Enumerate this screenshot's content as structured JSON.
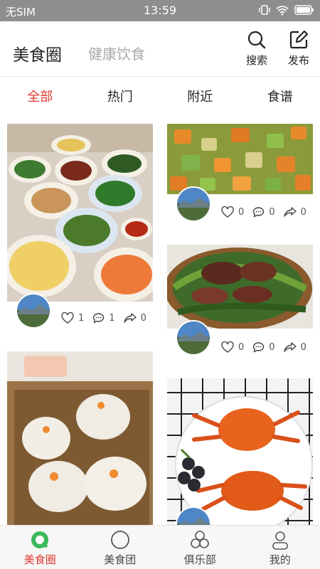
{
  "status_bar": {
    "carrier": "无SIM",
    "time": "13:59"
  },
  "header": {
    "title": "美食圈",
    "subtitle": "健康饮食",
    "search_label": "搜索",
    "publish_label": "发布"
  },
  "tabs": [
    {
      "label": "全部",
      "active": true
    },
    {
      "label": "热门",
      "active": false
    },
    {
      "label": "附近",
      "active": false
    },
    {
      "label": "食谱",
      "active": false
    }
  ],
  "posts": [
    {
      "likes": "1",
      "comments": "1",
      "shares": "0",
      "image": "table-of-dishes-photo"
    },
    {
      "likes": "0",
      "comments": "0",
      "shares": "0",
      "image": "stir-fried-vegetables-photo"
    },
    {
      "likes": "0",
      "comments": "0",
      "shares": "0",
      "image": "beef-with-greens-photo"
    },
    {
      "image": "shrimp-dumplings-photo"
    },
    {
      "image": "steamed-crabs-photo"
    }
  ],
  "bottom_nav": [
    {
      "label": "美食圈",
      "active": true
    },
    {
      "label": "美食团",
      "active": false
    },
    {
      "label": "俱乐部",
      "active": false
    },
    {
      "label": "我的",
      "active": false
    }
  ],
  "colors": {
    "accent": "#e03a30",
    "status_bar": "#8e8e8e",
    "nav_background": "#f7f7f7"
  }
}
